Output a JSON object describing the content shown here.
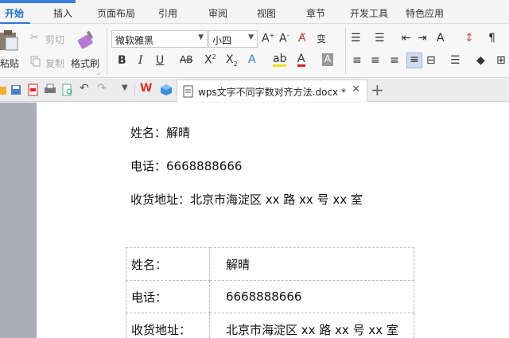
{
  "menu": {
    "tabs": [
      "开始",
      "插入",
      "页面布局",
      "引用",
      "审阅",
      "视图",
      "章节",
      "开发工具",
      "特色应用"
    ]
  },
  "ribbon": {
    "paste_label": "粘贴",
    "cut_label": "剪切",
    "copy_label": "复制",
    "format_painter_label": "格式刷",
    "font_name": "微软雅黑",
    "font_size": "小四"
  },
  "doc_tab": {
    "title": "wps文字不同字数对齐方法.docx *"
  },
  "document": {
    "lines": [
      "姓名：解晴",
      "电话：6668888666",
      "收货地址：北京市海淀区 xx 路 xx 号 xx 室"
    ],
    "table_rows": [
      {
        "label": "姓名：",
        "value": "解晴"
      },
      {
        "label": "电话：",
        "value": "6668888666"
      },
      {
        "label": "收货地址：",
        "value": "北京市海淀区 xx 路 xx 号 xx 室"
      }
    ]
  },
  "colors": {
    "accent": "#2b79d6",
    "gutter": "#a8adb8"
  }
}
